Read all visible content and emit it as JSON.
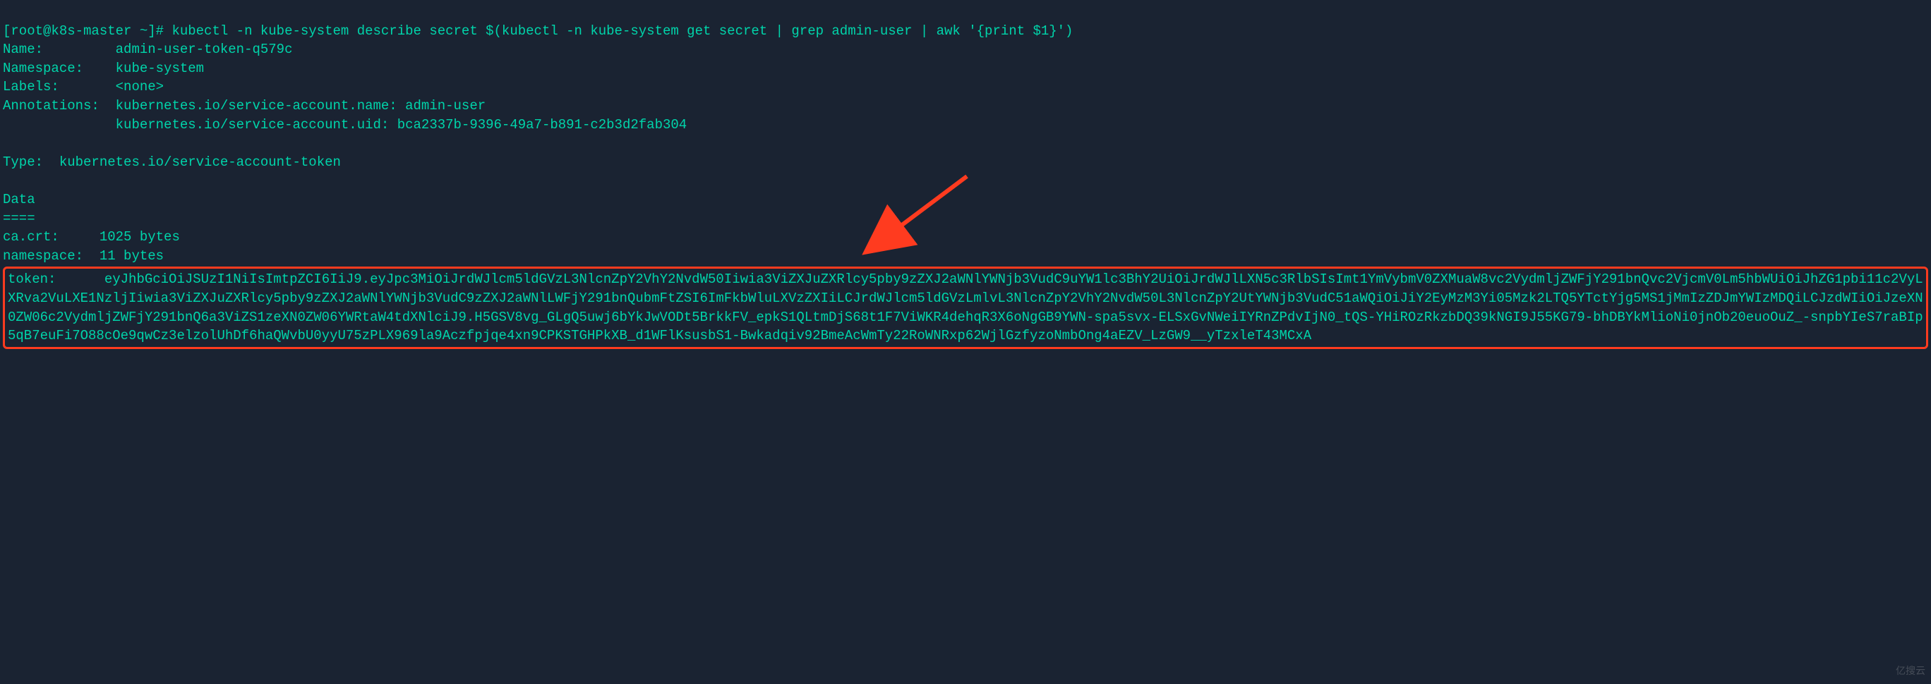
{
  "prompt": {
    "user_host": "[root@k8s-master ~]#",
    "command": "kubectl -n kube-system describe secret $(kubectl -n kube-system get secret | grep admin-user | awk '{print $1}')"
  },
  "output": {
    "name_label": "Name:",
    "name_value": "admin-user-token-q579c",
    "namespace_label": "Namespace:",
    "namespace_value": "kube-system",
    "labels_label": "Labels:",
    "labels_value": "<none>",
    "annotations_label": "Annotations:",
    "annotations_line1": "kubernetes.io/service-account.name: admin-user",
    "annotations_line2": "kubernetes.io/service-account.uid: bca2337b-9396-49a7-b891-c2b3d2fab304",
    "type_label": "Type:",
    "type_value": "kubernetes.io/service-account-token",
    "data_header": "Data",
    "data_divider": "====",
    "cacrt_label": "ca.crt:",
    "cacrt_value": "1025 bytes",
    "ns_label": "namespace:",
    "ns_value": "11 bytes",
    "token_label": "token:",
    "token_value": "eyJhbGciOiJSUzI1NiIsImtpZCI6IiJ9.eyJpc3MiOiJrdWJlcm5ldGVzL3NlcnZpY2VhY2NvdW50Iiwia3ViZXJuZXRlcy5pby9zZXJ2aWNlYWNjb3VudC9uYW1lc3BhY2UiOiJrdWJlLXN5c3RlbSIsImt1YmVybmV0ZXMuaW8vc2VydmljZWFjY291bnQvc2VjcmV0Lm5hbWUiOiJhZG1pbi11c2VyLXRva2VuLXE1NzljIiwia3ViZXJuZXRlcy5pby9zZXJ2aWNlYWNjb3VudC9zZXJ2aWNlLWFjY291bnQubmFtZSI6ImFkbWluLXVzZXIiLCJrdWJlcm5ldGVzLmlvL3NlcnZpY2VhY2NvdW50L3NlcnZpY2UtYWNjb3VudC51aWQiOiJiY2EyMzM3Yi05Mzk2LTQ5YTctYjg5MS1jMmIzZDJmYWIzMDQiLCJzdWIiOiJzeXN0ZW06c2VydmljZWFjY291bnQ6a3ViZS1zeXN0ZW06YWRtaW4tdXNlciJ9.H5GSV8vg_GLgQ5uwj6bYkJwVODt5BrkkFV_epkS1QLtmDjS68t1F7ViWKR4dehqR3X6oNgGB9YWN-spa5svx-ELSxGvNWeiIYRnZPdvIjN0_tQS-YHiROzRkzbDQ39kNGI9J55KG79-bhDBYkMlioNi0jnOb20euoOuZ_-snpbYIeS7raBIp5qB7euFi7O88cOe9qwCz3elzolUhDf6haQWvbU0yyU75zPLX969la9Aczfpjqe4xn9CPKSTGHPkXB_d1WFlKsusbS1-Bwkadqiv92BmeAcWmTy22RoWNRxp62WjlGzfyzoNmbOng4aEZV_LzGW9__yTzxleT43MCxA"
  },
  "watermark": "亿搜云"
}
